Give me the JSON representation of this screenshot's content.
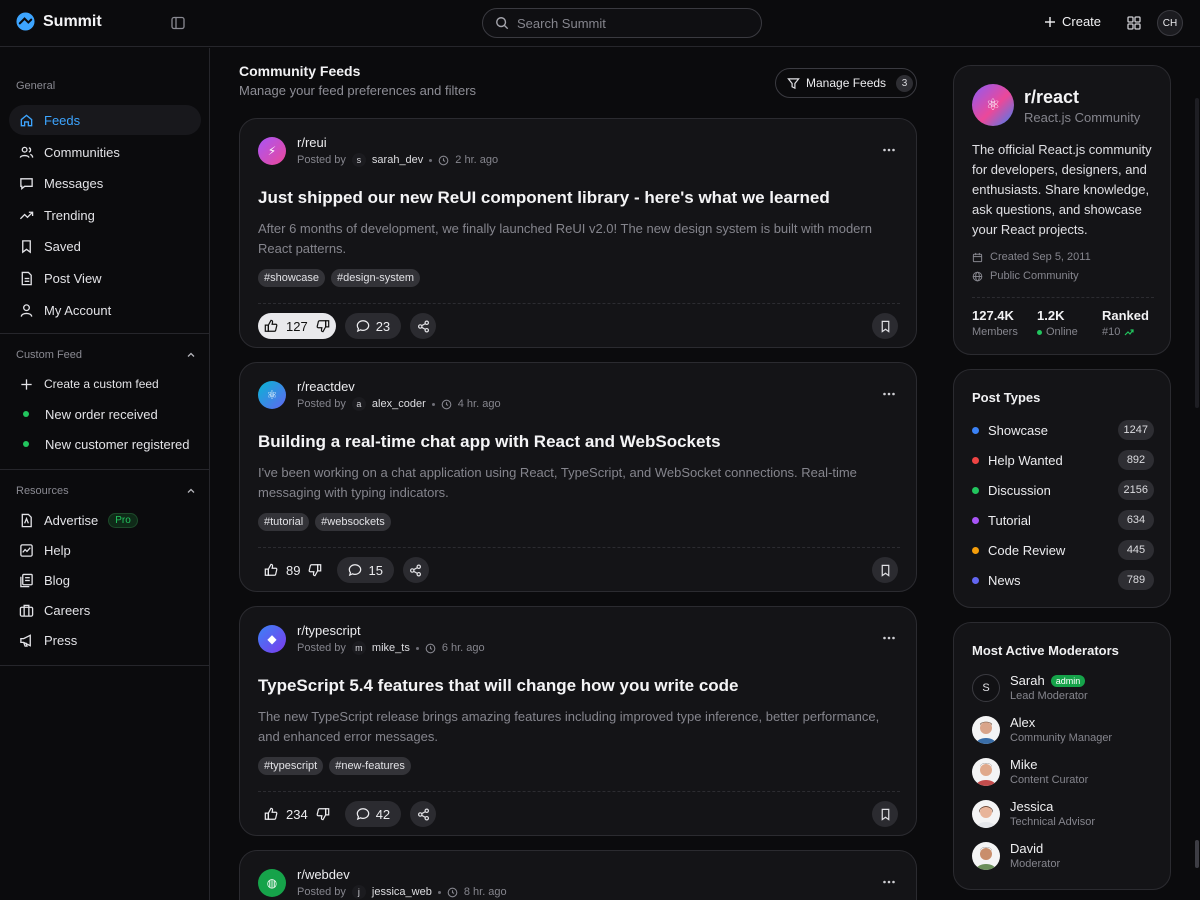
{
  "app": {
    "name": "Summit"
  },
  "search": {
    "placeholder": "Search Summit"
  },
  "header": {
    "create_label": "Create",
    "avatar_initials": "CH"
  },
  "sidebar": {
    "general_label": "General",
    "items": [
      {
        "label": "Feeds",
        "icon": "home-icon",
        "active": true
      },
      {
        "label": "Communities",
        "icon": "users-icon"
      },
      {
        "label": "Messages",
        "icon": "message-icon"
      },
      {
        "label": "Trending",
        "icon": "trending-icon"
      },
      {
        "label": "Saved",
        "icon": "bookmark-icon"
      },
      {
        "label": "Post View",
        "icon": "file-icon"
      },
      {
        "label": "My Account",
        "icon": "user-icon"
      }
    ],
    "custom_feed": {
      "label": "Custom Feed",
      "items": [
        {
          "label": "Create a custom feed",
          "icon": "plus-icon"
        },
        {
          "label": "New order received",
          "icon": "green-dot"
        },
        {
          "label": "New customer registered",
          "icon": "green-dot"
        }
      ]
    },
    "resources": {
      "label": "Resources",
      "items": [
        {
          "label": "Advertise",
          "icon": "ad-icon",
          "badge": "Pro"
        },
        {
          "label": "Help",
          "icon": "help-icon"
        },
        {
          "label": "Blog",
          "icon": "blog-icon"
        },
        {
          "label": "Careers",
          "icon": "briefcase-icon"
        },
        {
          "label": "Press",
          "icon": "megaphone-icon"
        }
      ]
    }
  },
  "main": {
    "title": "Community Feeds",
    "subtitle": "Manage your feed preferences and filters",
    "manage_label": "Manage Feeds",
    "manage_count": "3",
    "posted_by_label": "Posted by",
    "posts": [
      {
        "community": "r/reui",
        "avatar_glyph": "⚡",
        "avatar_color": "#c026d3",
        "user_initial": "s",
        "user": "sarah_dev",
        "time": "2 hr. ago",
        "title": "Just shipped our new ReUI component library - here's what we learned",
        "body": "After 6 months of development, we finally launched ReUI v2.0! The new design system is built with modern React patterns.",
        "tags": [
          "#showcase",
          "#design-system"
        ],
        "votes": "127",
        "comments": "23",
        "upvoted": true
      },
      {
        "community": "r/reactdev",
        "avatar_glyph": "⚛",
        "avatar_color": "#0ea5e9",
        "user_initial": "a",
        "user": "alex_coder",
        "time": "4 hr. ago",
        "title": "Building a real-time chat app with React and WebSockets",
        "body": "I've been working on a chat application using React, TypeScript, and WebSocket connections. Real-time messaging with typing indicators.",
        "tags": [
          "#tutorial",
          "#websockets"
        ],
        "votes": "89",
        "comments": "15",
        "upvoted": false
      },
      {
        "community": "r/typescript",
        "avatar_glyph": "◆",
        "avatar_color": "#4f46e5",
        "user_initial": "m",
        "user": "mike_ts",
        "time": "6 hr. ago",
        "title": "TypeScript 5.4 features that will change how you write code",
        "body": "The new TypeScript release brings amazing features including improved type inference, better performance, and enhanced error messages.",
        "tags": [
          "#typescript",
          "#new-features"
        ],
        "votes": "234",
        "comments": "42",
        "upvoted": false
      },
      {
        "community": "r/webdev",
        "avatar_glyph": "◍",
        "avatar_color": "#16a34a",
        "user_initial": "j",
        "user": "jessica_web",
        "time": "8 hr. ago",
        "title": "",
        "body": "",
        "tags": [],
        "votes": "",
        "comments": "",
        "upvoted": false
      }
    ]
  },
  "community": {
    "name": "r/react",
    "tagline": "React.js Community",
    "description": "The official React.js community for developers, designers, and enthusiasts. Share knowledge, ask questions, and showcase your React projects.",
    "created": "Created Sep 5, 2011",
    "visibility": "Public Community",
    "members_value": "127.4K",
    "members_label": "Members",
    "online_value": "1.2K",
    "online_label": "Online",
    "rank_value": "Ranked",
    "rank_label": "#10"
  },
  "post_types": {
    "title": "Post Types",
    "items": [
      {
        "label": "Showcase",
        "count": "1247",
        "color": "#3b82f6"
      },
      {
        "label": "Help Wanted",
        "count": "892",
        "color": "#ef4444"
      },
      {
        "label": "Discussion",
        "count": "2156",
        "color": "#22c55e"
      },
      {
        "label": "Tutorial",
        "count": "634",
        "color": "#a855f7"
      },
      {
        "label": "Code Review",
        "count": "445",
        "color": "#f59e0b"
      },
      {
        "label": "News",
        "count": "789",
        "color": "#6366f1"
      }
    ]
  },
  "moderators": {
    "title": "Most Active Moderators",
    "items": [
      {
        "name": "Sarah",
        "role": "Lead Moderator",
        "badge": "admin",
        "initial": "S"
      },
      {
        "name": "Alex",
        "role": "Community Manager"
      },
      {
        "name": "Mike",
        "role": "Content Curator"
      },
      {
        "name": "Jessica",
        "role": "Technical Advisor"
      },
      {
        "name": "David",
        "role": "Moderator"
      }
    ]
  },
  "colors": {
    "accent": "#3da5ff",
    "online": "#22c55e",
    "background": "#0b0b0d",
    "card": "#141417"
  }
}
